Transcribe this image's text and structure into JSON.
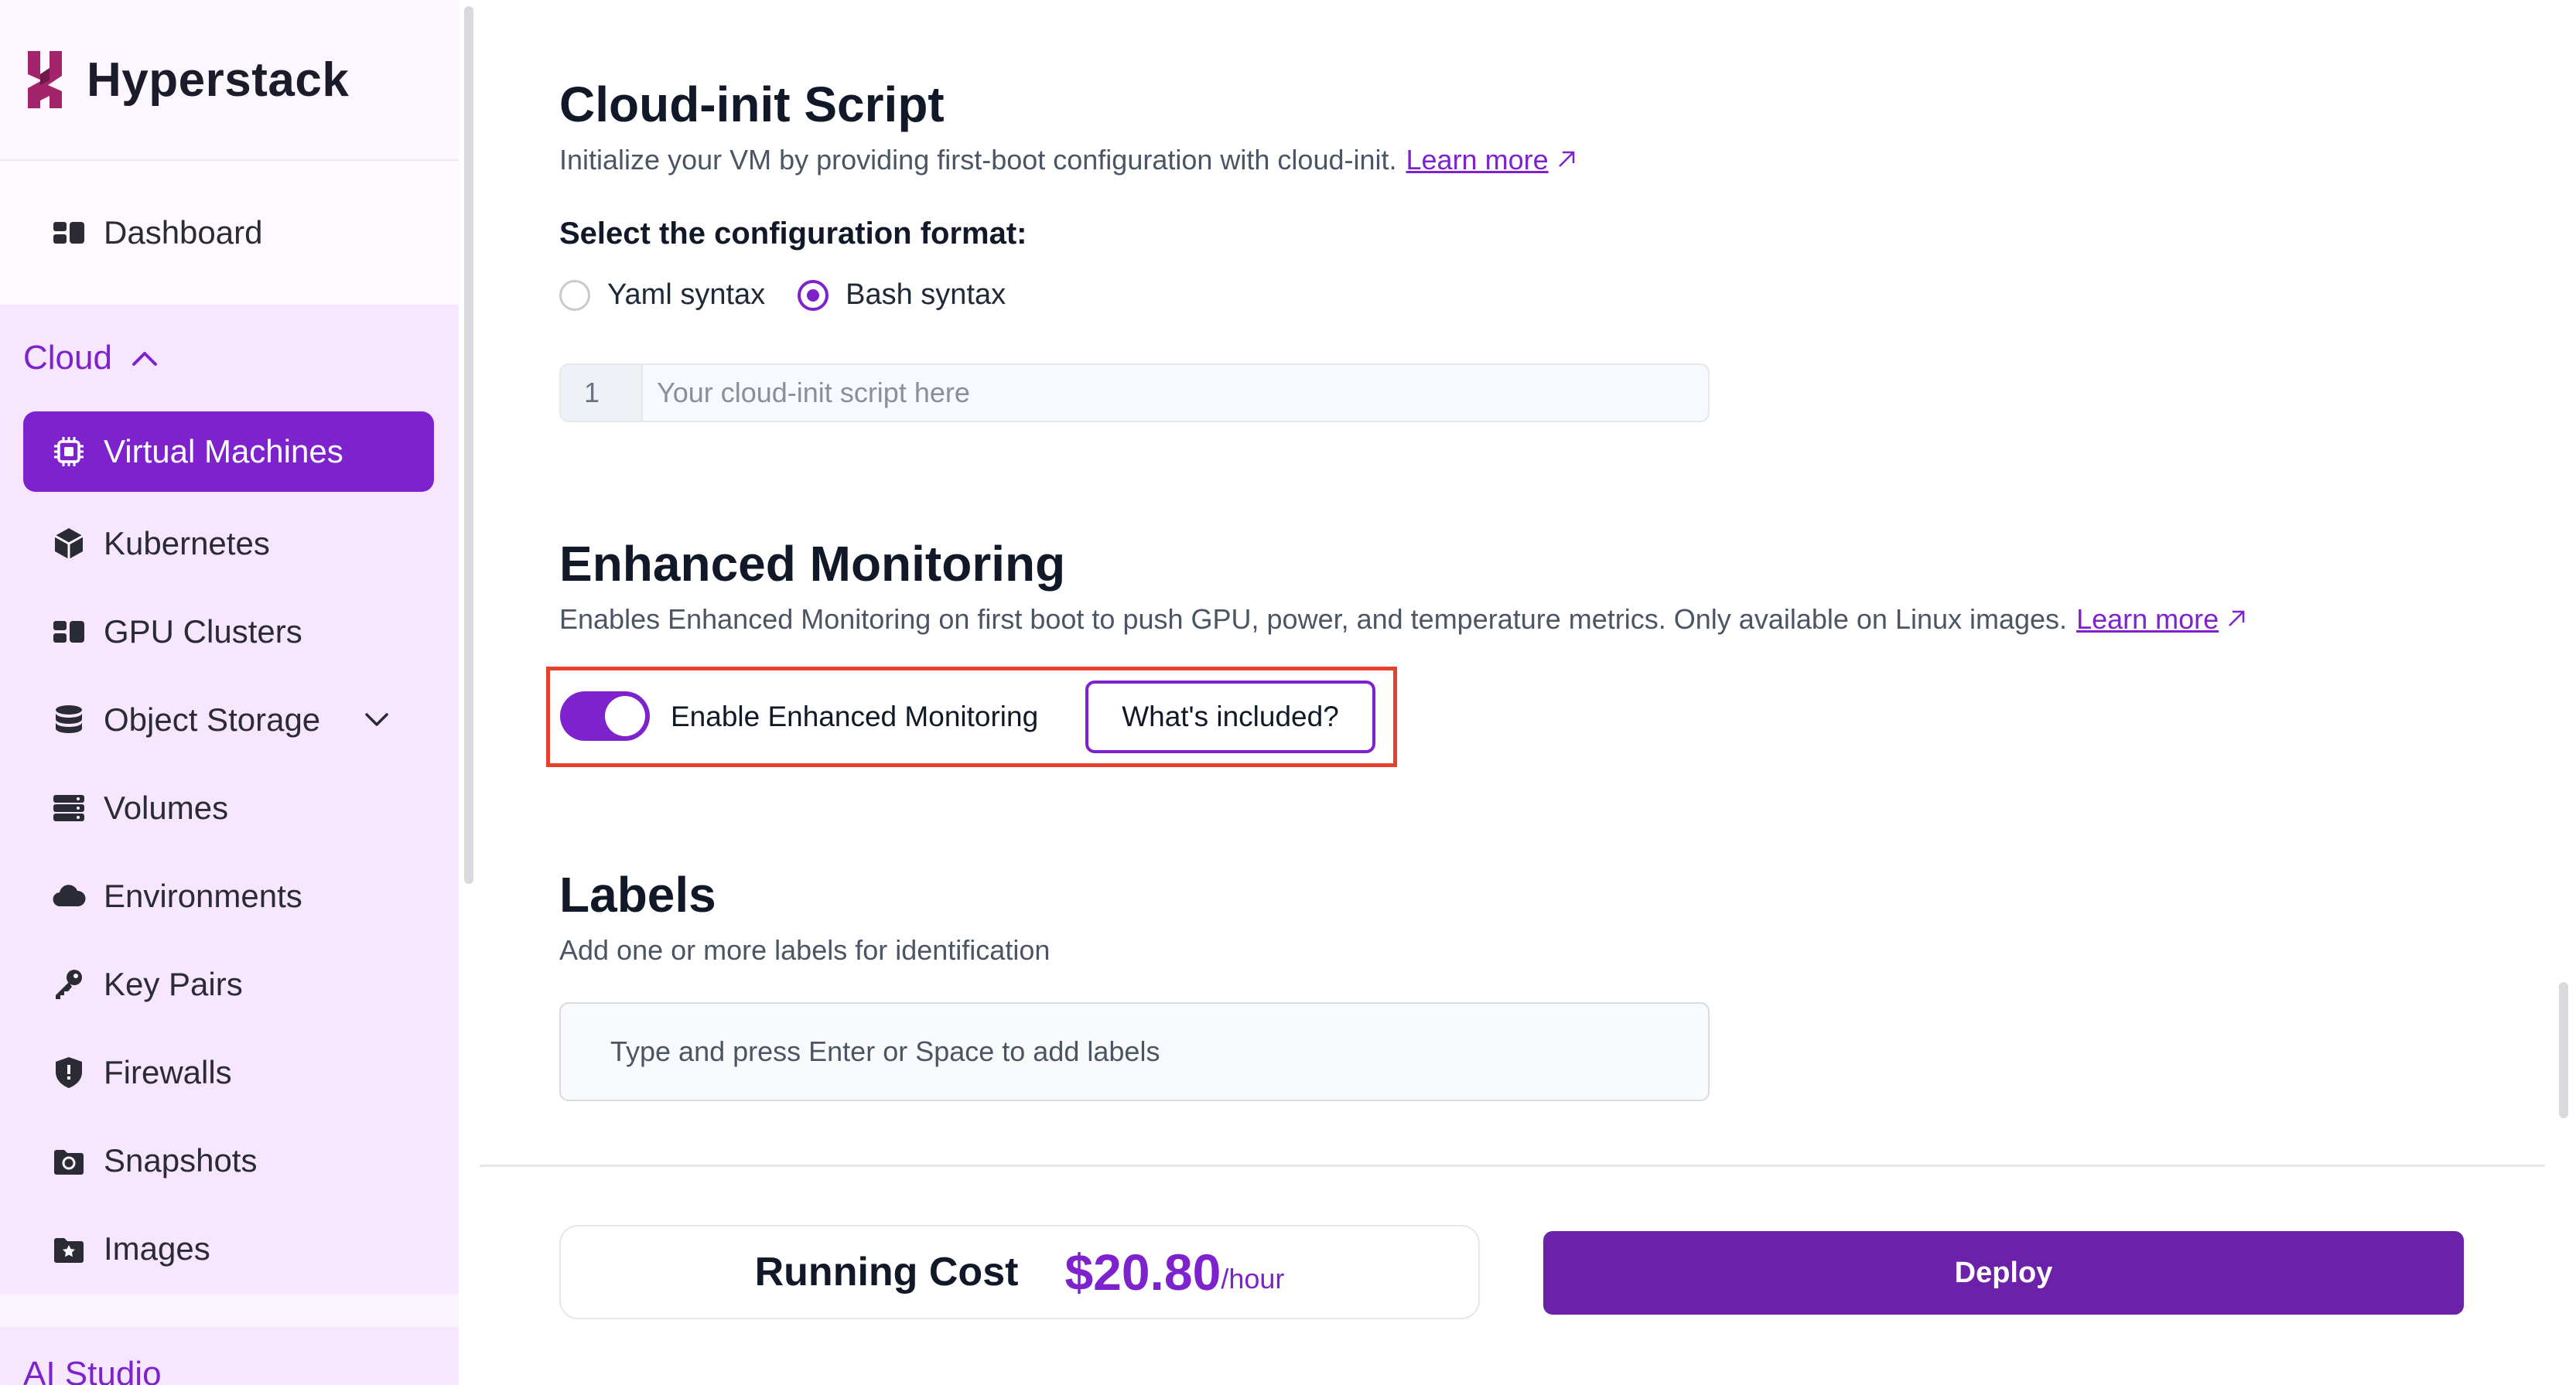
{
  "brand": {
    "name": "Hyperstack"
  },
  "sidebar": {
    "dashboard": {
      "label": "Dashboard",
      "icon": "dashboard-icon"
    },
    "cloud": {
      "title": "Cloud",
      "items": [
        {
          "label": "Virtual Machines",
          "icon": "chip-icon",
          "active": true
        },
        {
          "label": "Kubernetes",
          "icon": "cube-icon"
        },
        {
          "label": "GPU Clusters",
          "icon": "grid-icon"
        },
        {
          "label": "Object Storage",
          "icon": "database-icon",
          "expandable": true
        },
        {
          "label": "Volumes",
          "icon": "server-icon"
        },
        {
          "label": "Environments",
          "icon": "cloud-icon"
        },
        {
          "label": "Key Pairs",
          "icon": "key-icon"
        },
        {
          "label": "Firewalls",
          "icon": "shield-icon"
        },
        {
          "label": "Snapshots",
          "icon": "snapshot-icon"
        },
        {
          "label": "Images",
          "icon": "image-icon"
        }
      ]
    },
    "ai_studio": {
      "title": "AI Studio"
    }
  },
  "cloud_init": {
    "title": "Cloud-init Script",
    "description": "Initialize your VM by providing first-boot configuration with cloud-init.",
    "learn_more": "Learn more",
    "format_label": "Select the configuration format:",
    "formats": [
      {
        "label": "Yaml syntax",
        "checked": false
      },
      {
        "label": "Bash syntax",
        "checked": true
      }
    ],
    "line_number": "1",
    "placeholder": "Your cloud-init script here"
  },
  "monitoring": {
    "title": "Enhanced Monitoring",
    "description": "Enables Enhanced Monitoring on first boot to push GPU, power, and temperature metrics. Only available on Linux images.",
    "learn_more": "Learn more",
    "toggle_label": "Enable Enhanced Monitoring",
    "toggle_on": true,
    "whats_included": "What's included?"
  },
  "labels": {
    "title": "Labels",
    "description": "Add one or more labels for identification",
    "placeholder": "Type and press Enter or Space to add labels"
  },
  "footer": {
    "cost_label": "Running Cost",
    "cost_value": "$20.80",
    "cost_unit": "/hour",
    "deploy": "Deploy"
  },
  "colors": {
    "accent": "#7e22ce",
    "deploy": "#6b21a8",
    "highlight": "#e5412c"
  }
}
